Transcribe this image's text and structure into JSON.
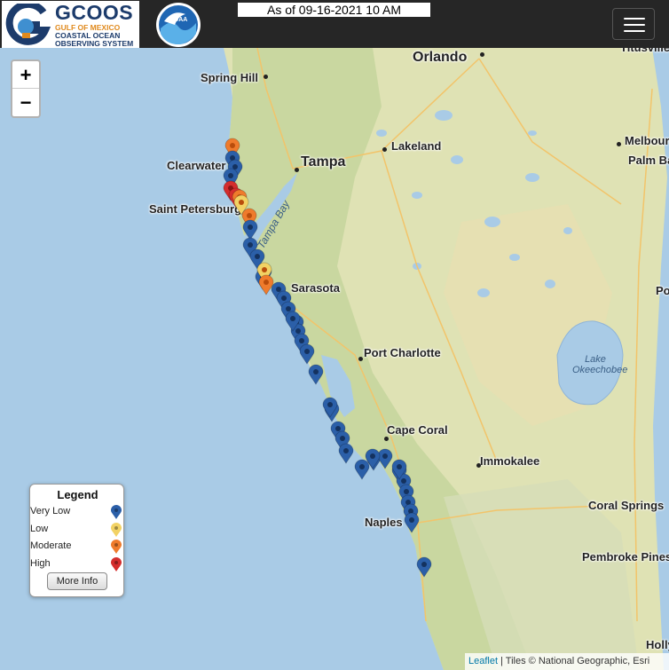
{
  "header": {
    "logo_title": "GCOOS",
    "logo_sub1": "GULF OF MEXICO",
    "logo_sub2": "COASTAL OCEAN",
    "logo_sub3": "OBSERVING SYSTEM",
    "noaa_text": "NOAA",
    "as_of": "As of 09-16-2021 10 AM"
  },
  "zoom": {
    "in_label": "+",
    "out_label": "−"
  },
  "places": [
    {
      "name": "Orlando",
      "size": "big"
    },
    {
      "name": "Titusville",
      "size": "normal"
    },
    {
      "name": "Spring Hill",
      "size": "normal"
    },
    {
      "name": "Lakeland",
      "size": "normal"
    },
    {
      "name": "Tampa",
      "size": "big"
    },
    {
      "name": "Clearwater",
      "size": "normal"
    },
    {
      "name": "Saint Petersburg",
      "size": "normal"
    },
    {
      "name": "Melbourne",
      "size": "normal"
    },
    {
      "name": "Palm Bay",
      "size": "normal"
    },
    {
      "name": "Sarasota",
      "size": "normal"
    },
    {
      "name": "Port Charlotte",
      "size": "normal"
    },
    {
      "name": "Cape Coral",
      "size": "normal"
    },
    {
      "name": "Immokalee",
      "size": "normal"
    },
    {
      "name": "Naples",
      "size": "normal"
    },
    {
      "name": "Coral Springs",
      "size": "normal"
    },
    {
      "name": "Pembroke Pines",
      "size": "normal"
    },
    {
      "name": "Port St. Lucie",
      "size": "normal"
    },
    {
      "name": "Hollywood",
      "size": "normal"
    }
  ],
  "water_labels": {
    "lake_line1": "Lake",
    "lake_line2": "Okeechobee",
    "bay": "Tampa Bay"
  },
  "legend": {
    "title": "Legend",
    "items": [
      {
        "label": "Very Low",
        "color": "#2b5fa8"
      },
      {
        "label": "Low",
        "color": "#f2d264"
      },
      {
        "label": "Moderate",
        "color": "#ef7b2c"
      },
      {
        "label": "High",
        "color": "#d42d2d"
      }
    ],
    "button": "More Info"
  },
  "markers": [
    {
      "level": "Moderate"
    },
    {
      "level": "Very Low"
    },
    {
      "level": "Very Low"
    },
    {
      "level": "Very Low"
    },
    {
      "level": "High"
    },
    {
      "level": "High"
    },
    {
      "level": "Moderate"
    },
    {
      "level": "Low"
    },
    {
      "level": "Moderate"
    },
    {
      "level": "Very Low"
    },
    {
      "level": "Very Low"
    },
    {
      "level": "Very Low"
    },
    {
      "level": "Very Low"
    },
    {
      "level": "Very Low"
    },
    {
      "level": "Low"
    },
    {
      "level": "Moderate"
    },
    {
      "level": "Very Low"
    },
    {
      "level": "Very Low"
    },
    {
      "level": "Very Low"
    },
    {
      "level": "Very Low"
    },
    {
      "level": "Very Low"
    },
    {
      "level": "Very Low"
    },
    {
      "level": "Very Low"
    },
    {
      "level": "Very Low"
    },
    {
      "level": "Very Low"
    },
    {
      "level": "Very Low"
    },
    {
      "level": "Very Low"
    },
    {
      "level": "Very Low"
    },
    {
      "level": "Very Low"
    },
    {
      "level": "Very Low"
    },
    {
      "level": "Very Low"
    },
    {
      "level": "Very Low"
    },
    {
      "level": "Very Low"
    },
    {
      "level": "Very Low"
    },
    {
      "level": "Very Low"
    },
    {
      "level": "Very Low"
    },
    {
      "level": "Very Low"
    },
    {
      "level": "Very Low"
    },
    {
      "level": "Very Low"
    },
    {
      "level": "Very Low"
    },
    {
      "level": "Very Low"
    },
    {
      "level": "Very Low"
    }
  ],
  "attribution": {
    "link": "Leaflet",
    "text": " | Tiles © National Geographic, Esri"
  }
}
